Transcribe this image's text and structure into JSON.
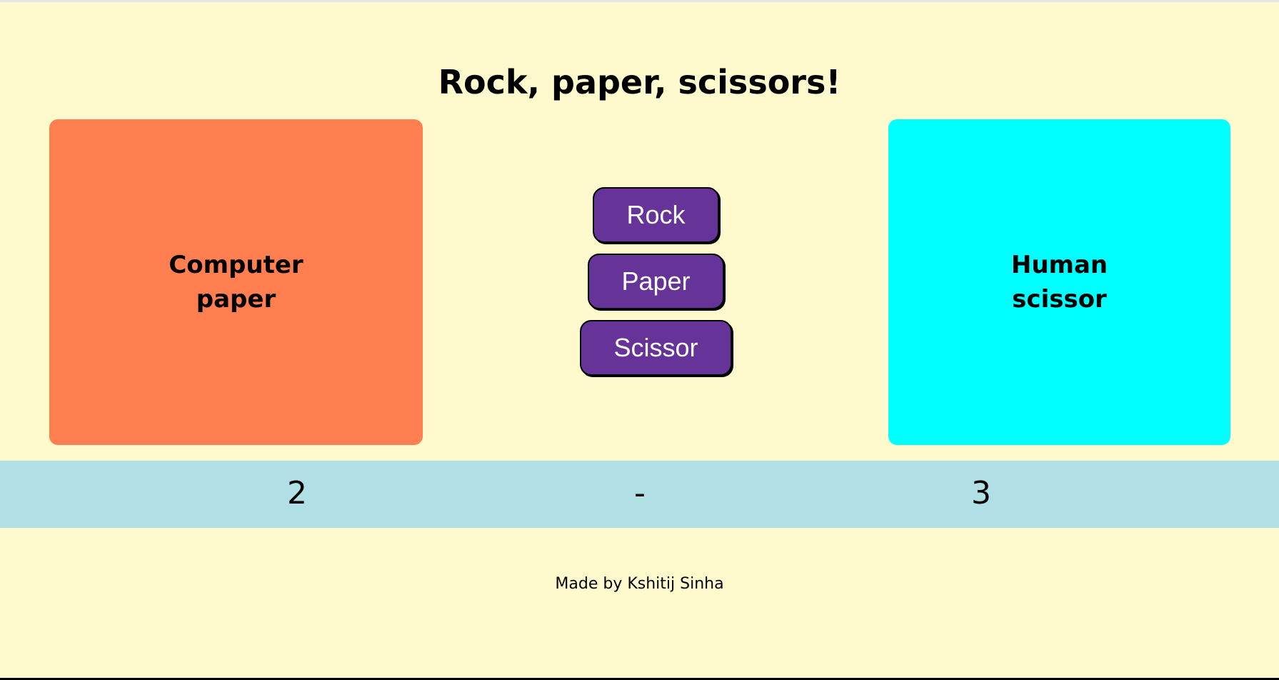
{
  "title": "Rock, paper, scissors!",
  "computer_panel": {
    "label": "Computer",
    "choice": "paper",
    "color": "#ff7f50"
  },
  "human_panel": {
    "label": "Human",
    "choice": "scissor",
    "color": "#00ffff"
  },
  "choices": {
    "rock_label": "Rock",
    "paper_label": "Paper",
    "scissor_label": "Scissor",
    "button_color": "#663399"
  },
  "score": {
    "computer": "2",
    "separator": "-",
    "human": "3",
    "bar_color": "#b0e0e6"
  },
  "footer": {
    "credit": "Made by Kshitij Sinha"
  },
  "page_background": "#fffacd"
}
